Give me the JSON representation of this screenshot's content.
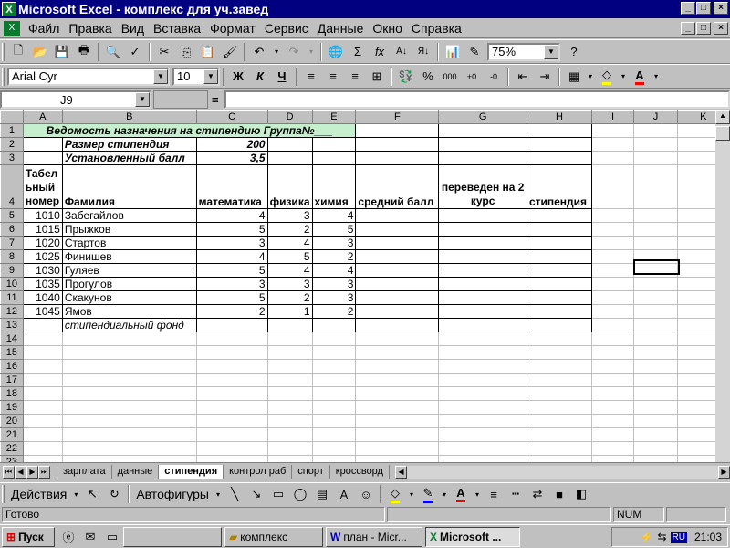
{
  "window": {
    "title": "Microsoft Excel - комплекс для уч.завед"
  },
  "menu": [
    "Файл",
    "Правка",
    "Вид",
    "Вставка",
    "Формат",
    "Сервис",
    "Данные",
    "Окно",
    "Справка"
  ],
  "standard_toolbar": {
    "zoom": "75%"
  },
  "format_toolbar": {
    "font": "Arial Cyr",
    "size": "10",
    "bold": "Ж",
    "italic": "К",
    "underline": "Ч",
    "percent": "%",
    "thousands": "000"
  },
  "formula_bar": {
    "name_box": "J9",
    "equals": "=",
    "value": ""
  },
  "columns": [
    "A",
    "B",
    "C",
    "D",
    "E",
    "F",
    "G",
    "H",
    "I",
    "J",
    "K"
  ],
  "sheet": {
    "title": "Ведомость назначения на стипендию  Группа№___",
    "stipend_label": "Размер стипендия",
    "stipend_value": "200",
    "score_label": "Установленный балл",
    "score_value": "3,5",
    "headers": {
      "tabel": "Табел ьный номер",
      "name": "Фамилия",
      "math": "математика",
      "physics": "физика",
      "chemistry": "химия",
      "avg": "средний балл",
      "transfer": "переведен на 2 курс",
      "stipend": "стипендия"
    },
    "students": [
      {
        "id": "1010",
        "name": "Забегайлов",
        "math": "4",
        "phys": "3",
        "chem": "4"
      },
      {
        "id": "1015",
        "name": "Прыжков",
        "math": "5",
        "phys": "2",
        "chem": "5"
      },
      {
        "id": "1020",
        "name": "Стартов",
        "math": "3",
        "phys": "4",
        "chem": "3"
      },
      {
        "id": "1025",
        "name": "Финишев",
        "math": "4",
        "phys": "5",
        "chem": "2"
      },
      {
        "id": "1030",
        "name": "Гуляев",
        "math": "5",
        "phys": "4",
        "chem": "4"
      },
      {
        "id": "1035",
        "name": "Прогулов",
        "math": "3",
        "phys": "3",
        "chem": "3"
      },
      {
        "id": "1040",
        "name": "Скакунов",
        "math": "5",
        "phys": "2",
        "chem": "3"
      },
      {
        "id": "1045",
        "name": "Ямов",
        "math": "2",
        "phys": "1",
        "chem": "2"
      }
    ],
    "fund_label": "стипендиальный фонд"
  },
  "sheet_tabs": [
    "зарплата",
    "данные",
    "стипендия",
    "контрол раб",
    "спорт",
    "кроссворд"
  ],
  "active_tab": "стипендия",
  "drawing_toolbar": {
    "actions": "Действия",
    "autoshapes": "Автофигуры"
  },
  "status": {
    "ready": "Готово",
    "num": "NUM"
  },
  "taskbar": {
    "start": "Пуск",
    "buttons": [
      "комплекс",
      "план - Micr...",
      "Microsoft ..."
    ],
    "lang": "RU",
    "clock": "21:03"
  },
  "colors": {
    "title_bg": "#000080",
    "header_highlight": "#c6efce"
  }
}
